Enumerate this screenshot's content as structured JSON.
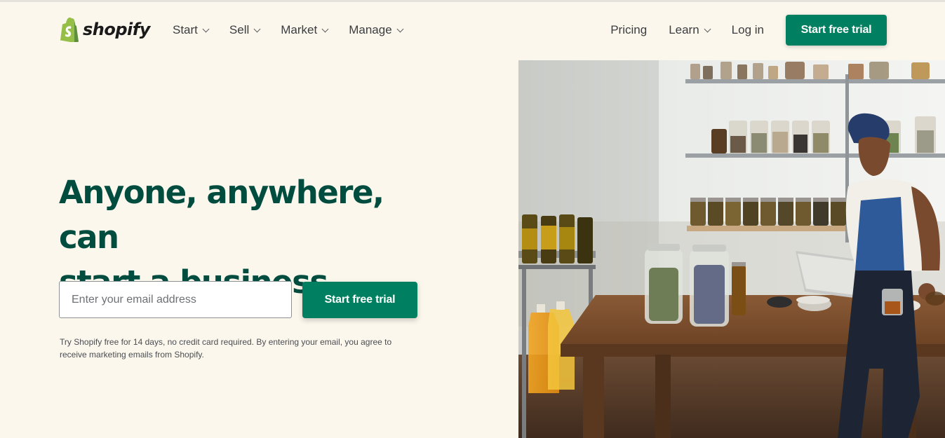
{
  "brand": {
    "name": "shopify",
    "accent": "#008060",
    "heading_color": "#004c3f",
    "background": "#fbf7ed",
    "logo_color": "#95bf47"
  },
  "nav": {
    "left": [
      {
        "label": "Start",
        "icon": "chevron-down-icon"
      },
      {
        "label": "Sell",
        "icon": "chevron-down-icon"
      },
      {
        "label": "Market",
        "icon": "chevron-down-icon"
      },
      {
        "label": "Manage",
        "icon": "chevron-down-icon"
      }
    ],
    "right": {
      "pricing": "Pricing",
      "learn": "Learn",
      "login": "Log in"
    },
    "cta": "Start free trial"
  },
  "hero": {
    "title_line1": "Anyone, anywhere, can",
    "title_line2": "start a business",
    "email_placeholder": "Enter your email address",
    "email_value": "",
    "cta": "Start free trial",
    "disclaimer": "Try Shopify free for 14 days, no credit card required. By entering your email, you agree to receive marketing emails from Shopify."
  }
}
